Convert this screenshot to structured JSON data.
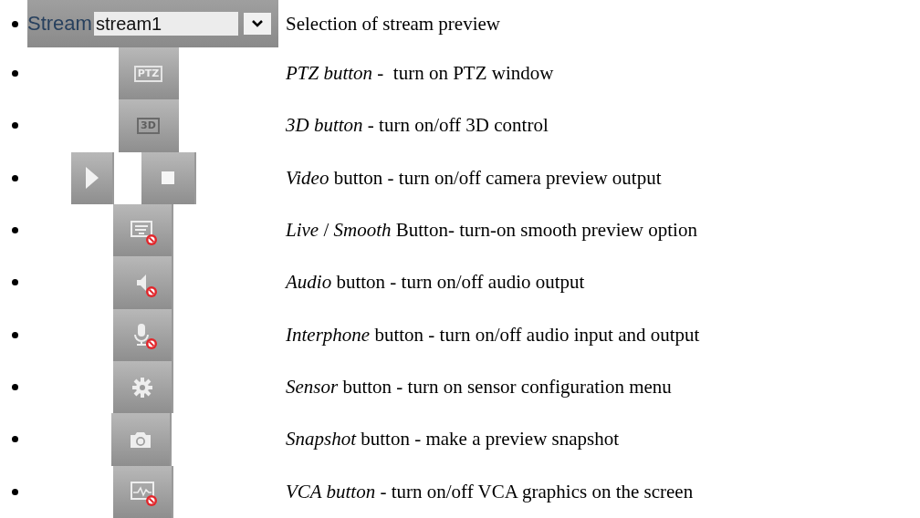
{
  "items": [
    {
      "kind": "stream",
      "label": "Stream",
      "value": "stream1",
      "description": "Selection of stream preview"
    },
    {
      "kind": "ptz",
      "badge": "PTZ",
      "description": "*PTZ button* -  turn on PTZ window"
    },
    {
      "kind": "threed",
      "badge": "3D",
      "description": "*3D button* - turn on/off 3D control"
    },
    {
      "kind": "video",
      "description": "*Video* button - turn on/off camera preview output"
    },
    {
      "kind": "smooth",
      "description": "*Live* / *Smooth* Button- turn-on smooth preview option"
    },
    {
      "kind": "audio",
      "description": "*Audio* button - turn on/off audio output"
    },
    {
      "kind": "mic",
      "description": "*Interphone* button - turn on/off audio input and output"
    },
    {
      "kind": "gear",
      "description": "*Sensor* button - turn on sensor configuration menu"
    },
    {
      "kind": "camera",
      "description": "*Snapshot* button - make a preview snapshot"
    },
    {
      "kind": "vca",
      "description": "*VCA button* - turn on/off VCA graphics on the screen"
    }
  ]
}
